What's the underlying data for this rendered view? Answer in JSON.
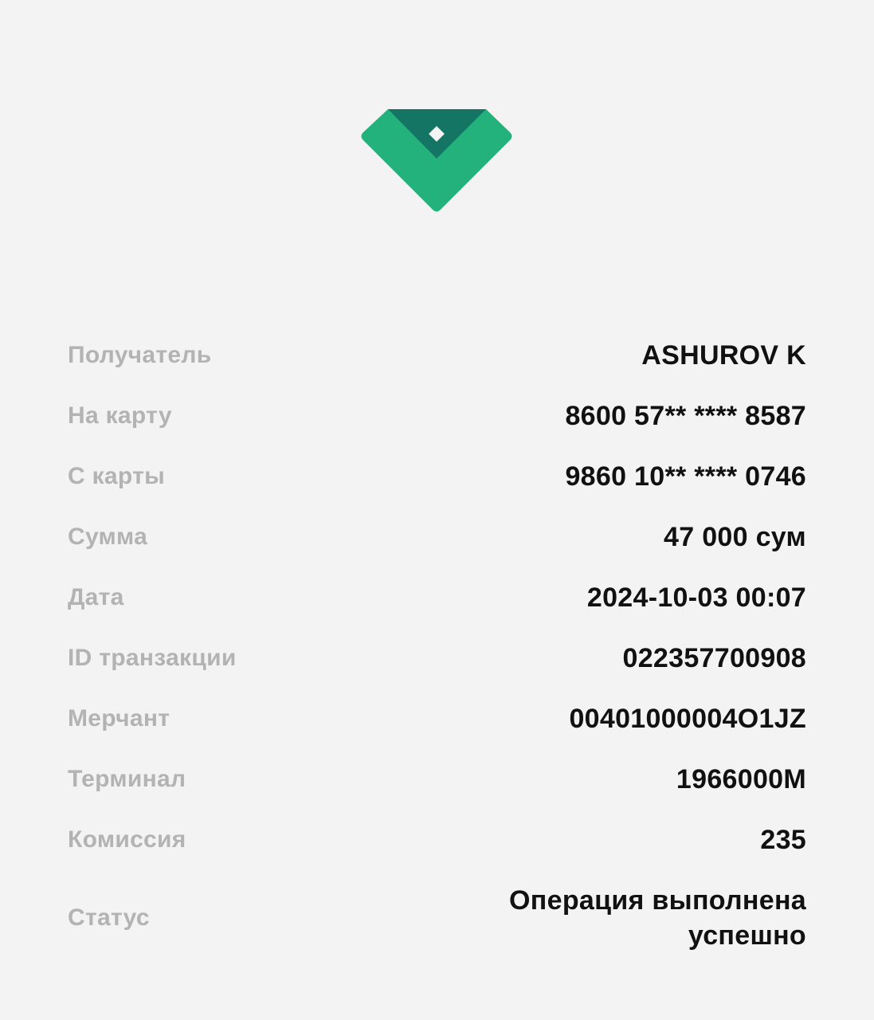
{
  "logo": {
    "icon": "diamond-shield-logo",
    "colors": {
      "primary": "#23b27c",
      "dark": "#147564",
      "inner": "#f3f3f3"
    }
  },
  "details": [
    {
      "label": "Получатель",
      "value": "ASHUROV K"
    },
    {
      "label": "На карту",
      "value": "8600 57** **** 8587"
    },
    {
      "label": "С карты",
      "value": "9860 10** **** 0746"
    },
    {
      "label": "Сумма",
      "value": "47 000 сум"
    },
    {
      "label": "Дата",
      "value": "2024-10-03 00:07"
    },
    {
      "label": "ID транзакции",
      "value": "022357700908"
    },
    {
      "label": "Мерчант",
      "value": "00401000004О1JZ"
    },
    {
      "label": "Терминал",
      "value": "1966000M"
    },
    {
      "label": "Комиссия",
      "value": "235"
    },
    {
      "label": "Статус",
      "value": "Операция выполнена успешно"
    }
  ]
}
